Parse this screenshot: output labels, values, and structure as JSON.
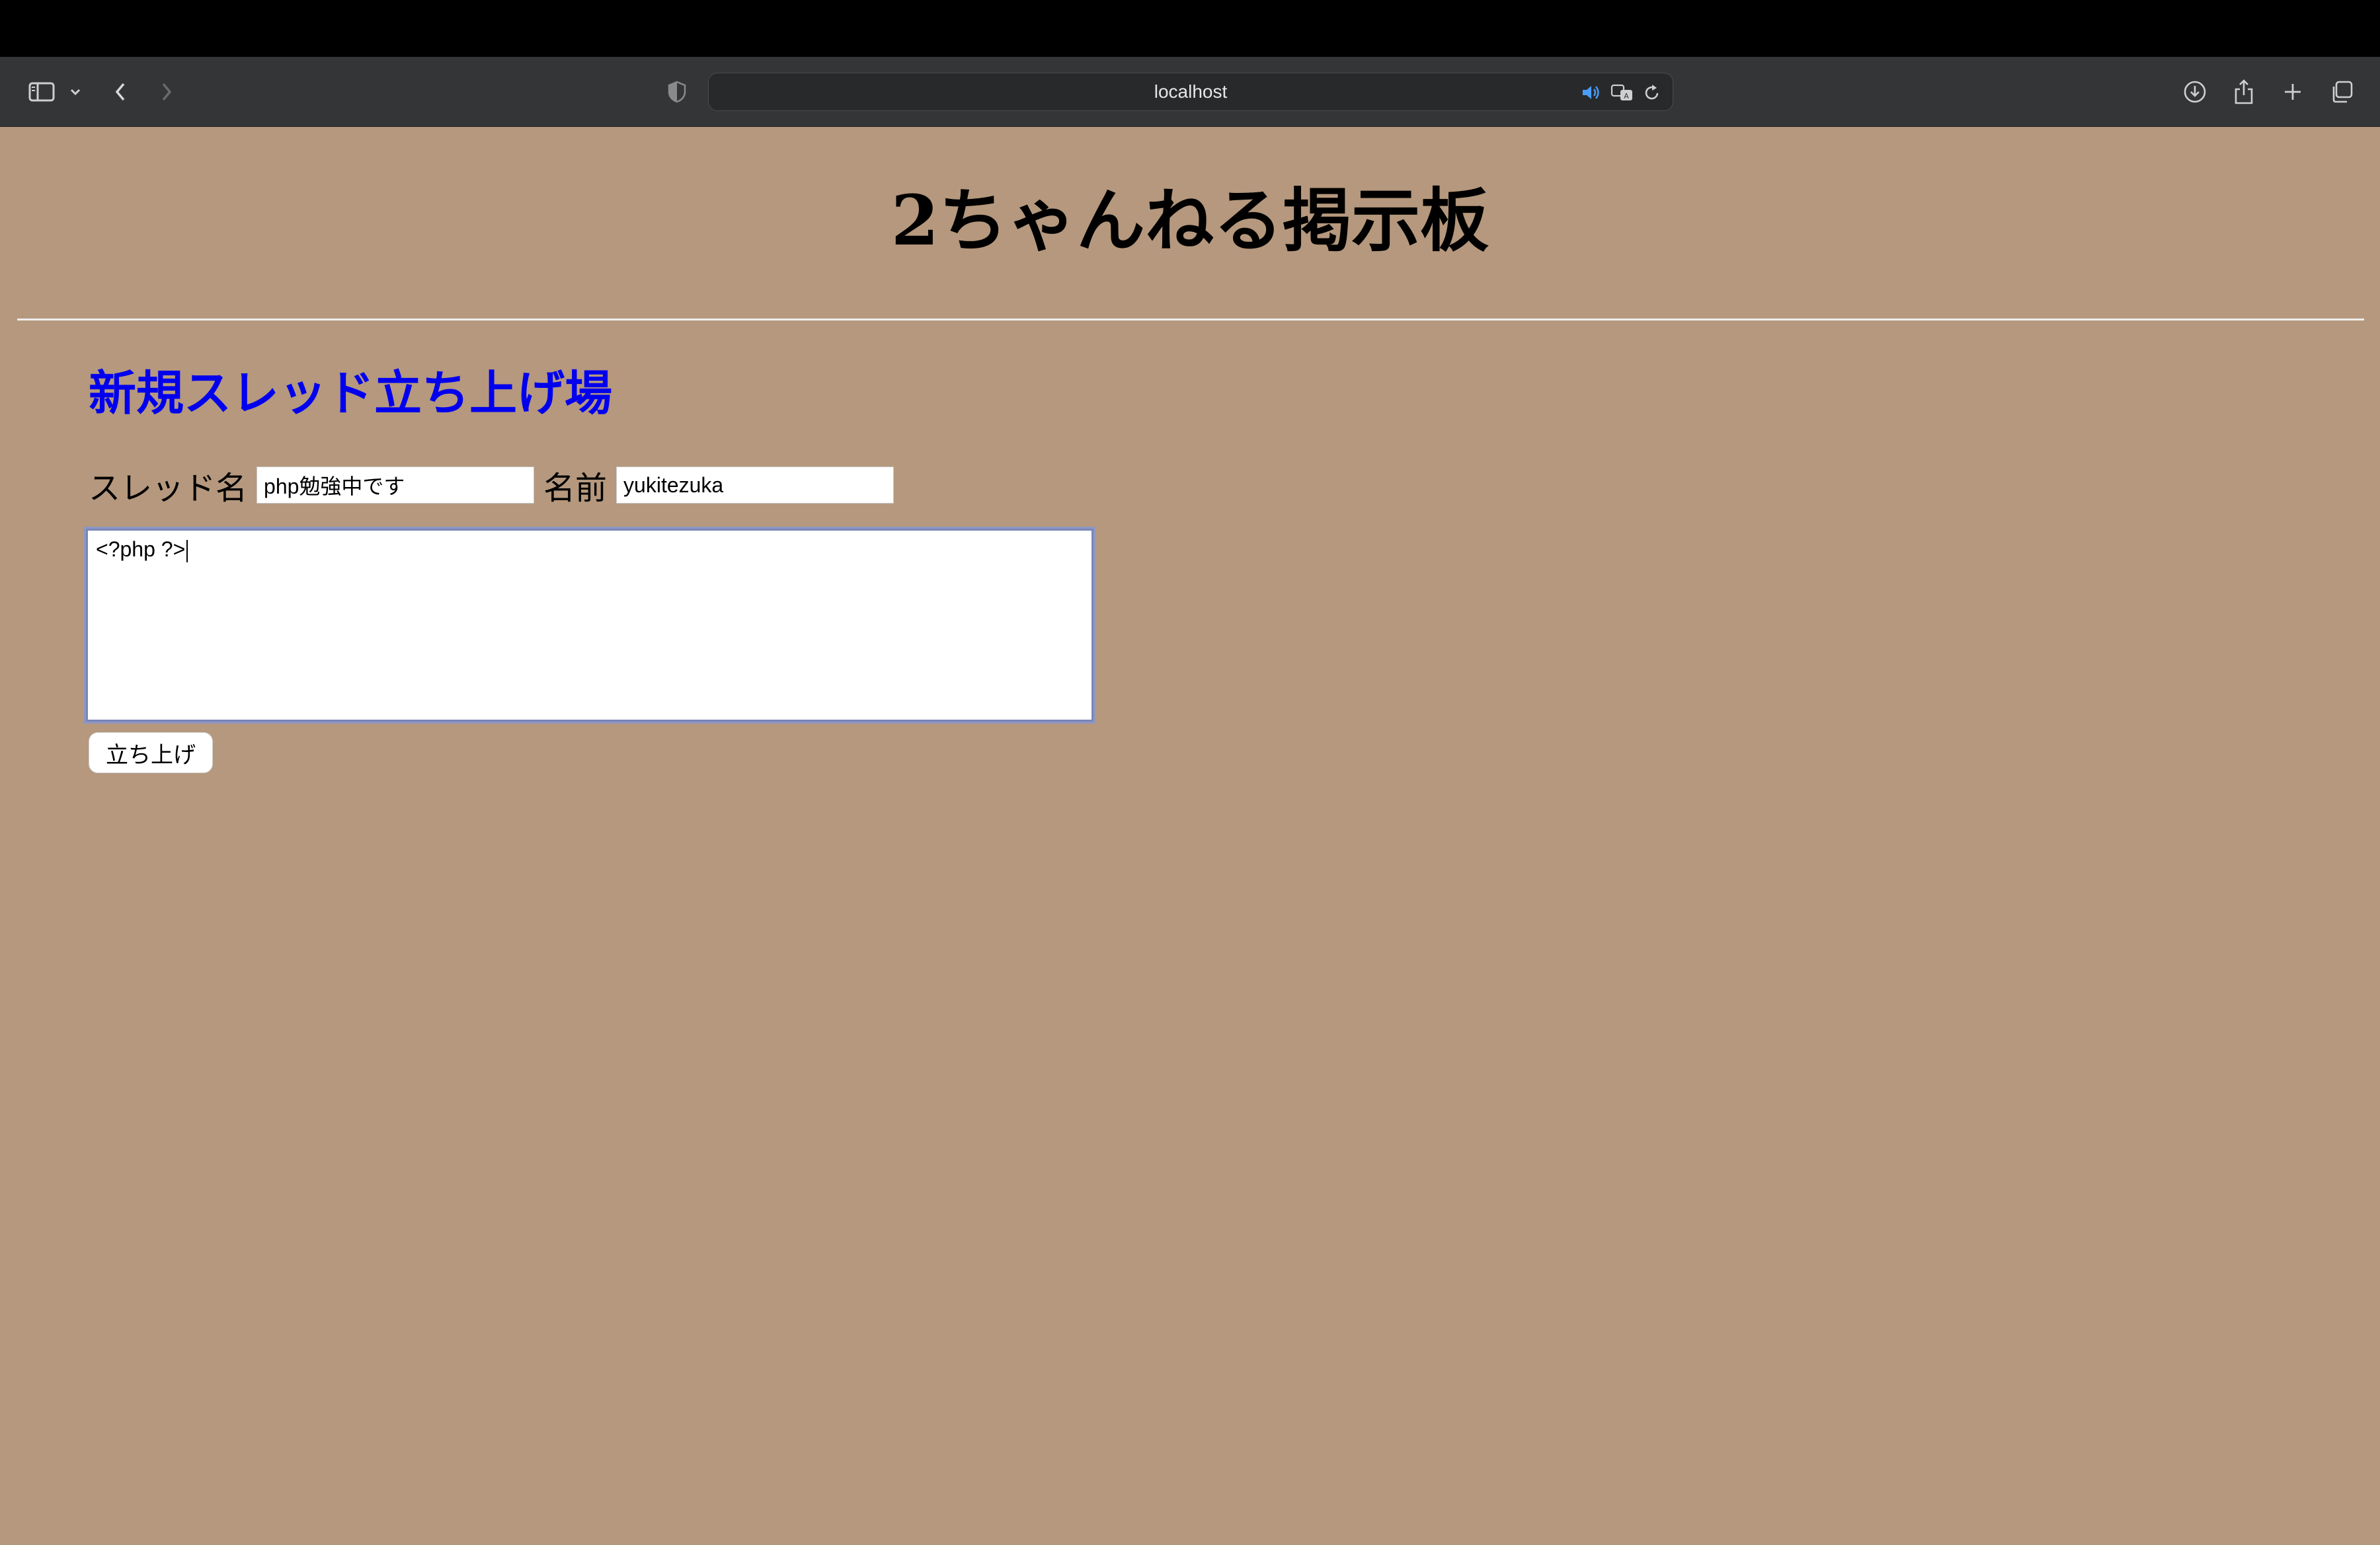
{
  "browser": {
    "url": "localhost"
  },
  "page": {
    "title": "2ちゃんねる掲示板",
    "section_title": "新規スレッド立ち上げ場",
    "thread_label": "スレッド名",
    "thread_value": "php勉強中です",
    "name_label": "名前",
    "name_value": "yukitezuka",
    "body_value": "<?php ?>",
    "submit_label": "立ち上げ"
  },
  "colors": {
    "page_background": "#b5987d",
    "section_title": "#0000ee",
    "toolbar": "#343537"
  }
}
